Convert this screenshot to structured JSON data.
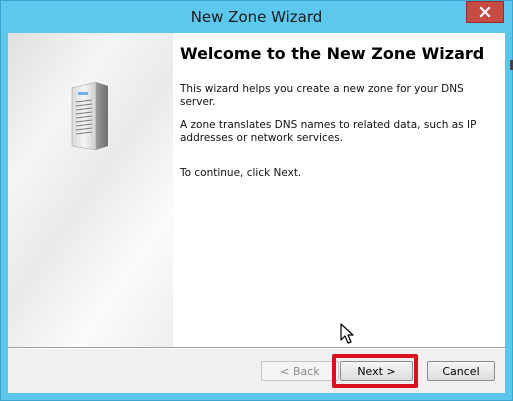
{
  "window": {
    "title": "New Zone Wizard"
  },
  "wizard": {
    "heading": "Welcome to the New Zone Wizard",
    "paragraph1": "This wizard helps you create a new zone for your DNS server.",
    "paragraph2": "A zone translates DNS names to related data, such as IP addresses or network services.",
    "paragraph3": "To continue, click Next."
  },
  "buttons": {
    "back": "< Back",
    "next": "Next >",
    "cancel": "Cancel"
  },
  "icons": {
    "close": "close-icon",
    "server": "server-icon",
    "cursor": "mouse-pointer-icon"
  },
  "colors": {
    "titlebar": "#5dc8ee",
    "close_button": "#c74a44",
    "highlight": "#d80f1c"
  }
}
